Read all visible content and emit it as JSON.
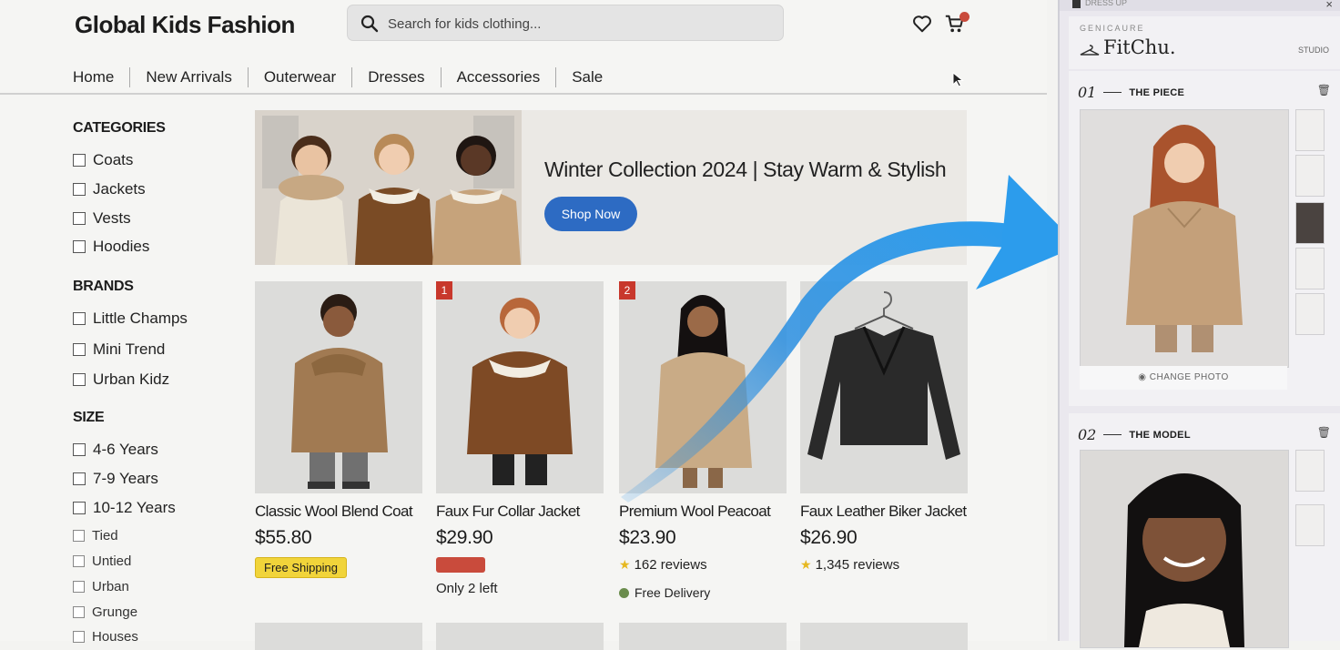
{
  "store": {
    "title": "Global Kids Fashion",
    "search_placeholder": "Search for kids clothing...",
    "cart_badge_color": "#c94b3c",
    "icons": [
      "search-icon",
      "heart-icon",
      "cart-icon"
    ]
  },
  "nav": {
    "items": [
      "Home",
      "New Arrivals",
      "Outerwear",
      "Dresses",
      "Accessories",
      "Sale"
    ]
  },
  "sidebar": {
    "categories_heading": "CATEGORIES",
    "categories": [
      "Coats",
      "Jackets",
      "Vests",
      "Hoodies"
    ],
    "brands_heading": "BRANDS",
    "brands": [
      "Little Champs",
      "Mini Trend",
      "Urban Kidz"
    ],
    "size_heading": "SIZE",
    "sizes": [
      "4-6 Years",
      "7-9 Years",
      "10-12 Years"
    ],
    "extra": [
      "Tied",
      "Untied",
      "Urban",
      "Grunge",
      "Houses"
    ]
  },
  "banner": {
    "title": "Winter Collection 2024 | Stay Warm & Stylish",
    "cta": "Shop Now",
    "cta_color": "#2d6bc3"
  },
  "products": [
    {
      "name": "Classic Wool Blend Coat",
      "price": "$55.80",
      "tag": "Free Shipping"
    },
    {
      "name": "Faux Fur Collar Jacket",
      "price": "$29.90",
      "badge": "1",
      "stock": "Only 2 left"
    },
    {
      "name": "Premium Wool Peacoat",
      "price": "$23.90",
      "badge": "2",
      "reviews": "162 reviews",
      "delivery": "Free Delivery"
    },
    {
      "name": "Faux Leather Biker Jacket",
      "price": "$26.90",
      "reviews": "1,345 reviews"
    }
  ],
  "panel": {
    "title_small": "DRESS UP",
    "brand_small": "GENICAURE",
    "brand": "FitChu.",
    "brand_right": "STUDIO",
    "close": "×",
    "sections": [
      {
        "num": "01",
        "label": "THE PIECE",
        "action": "CHANGE PHOTO"
      },
      {
        "num": "02",
        "label": "THE MODEL"
      }
    ]
  },
  "colors": {
    "accent_arrow": "#2a8ee0",
    "sale": "#c8382c",
    "shipping_tag": "#f1d43a"
  }
}
